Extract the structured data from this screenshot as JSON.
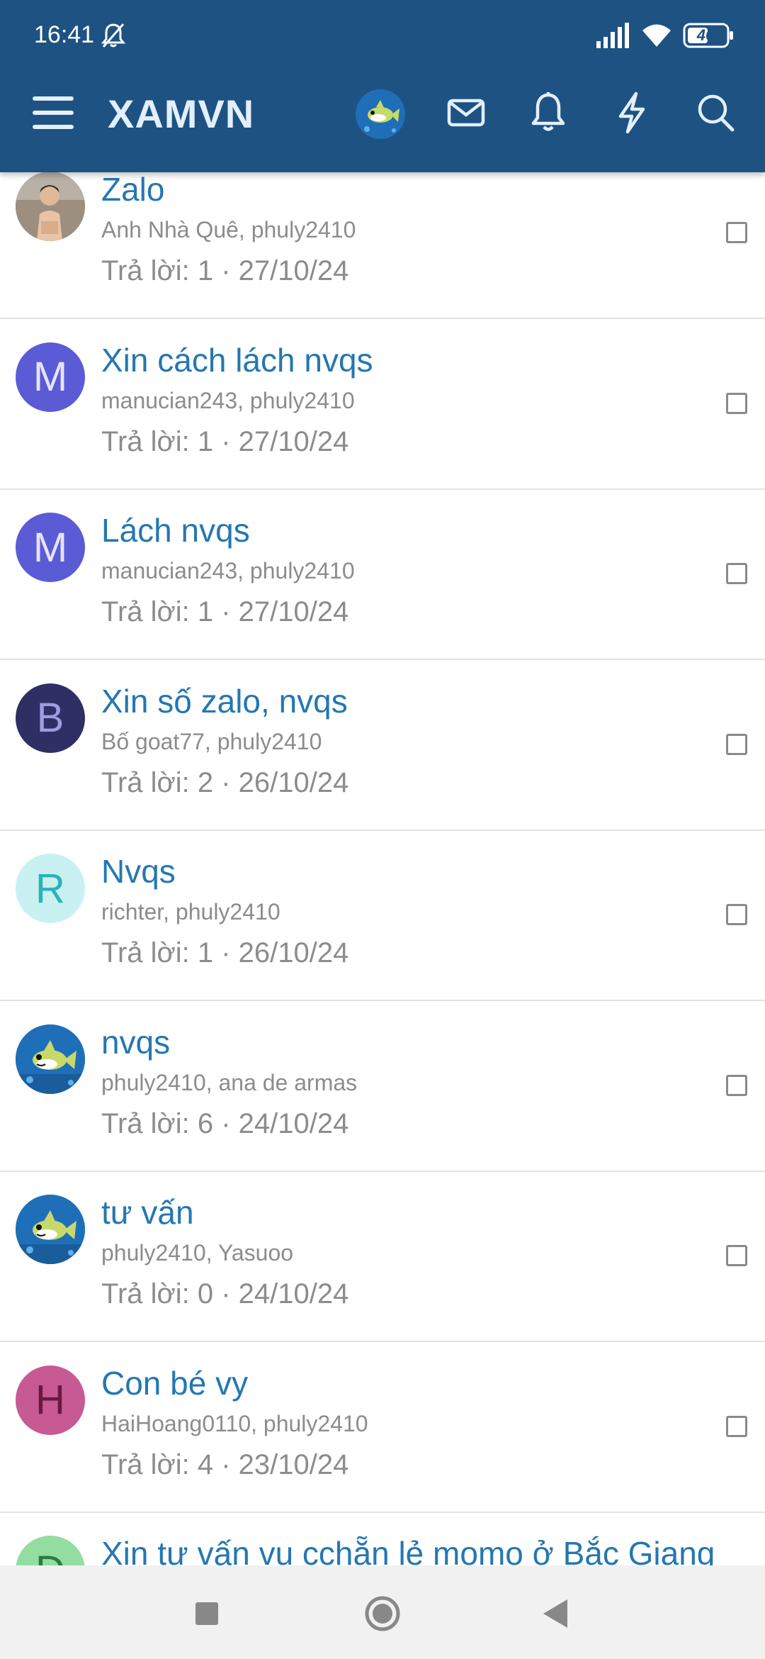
{
  "status_bar": {
    "time": "16:41",
    "battery": "46"
  },
  "app_bar": {
    "title": "XAMVN"
  },
  "colors": {
    "header_bg": "#1d5283",
    "title_link": "#2577b1",
    "muted_text": "#8c8c8c"
  },
  "threads": [
    {
      "title": "Zalo",
      "authors": "Anh Nhà Quê, phuly2410",
      "meta": "Trả lời: 1 · 27/10/24",
      "avatar": {
        "type": "photo",
        "letter": "",
        "bg": "#8a7b6a",
        "fg": "#ffffff"
      }
    },
    {
      "title": "Xin cách lách nvqs",
      "authors": "manucian243, phuly2410",
      "meta": "Trả lời: 1 · 27/10/24",
      "avatar": {
        "type": "letter",
        "letter": "M",
        "bg": "#5b5bd6",
        "fg": "#e6e4ff"
      }
    },
    {
      "title": "Lách nvqs",
      "authors": "manucian243, phuly2410",
      "meta": "Trả lời: 1 · 27/10/24",
      "avatar": {
        "type": "letter",
        "letter": "M",
        "bg": "#5b5bd6",
        "fg": "#e6e4ff"
      }
    },
    {
      "title": "Xin số zalo, nvqs",
      "authors": "Bố goat77, phuly2410",
      "meta": "Trả lời: 2 · 26/10/24",
      "avatar": {
        "type": "letter",
        "letter": "B",
        "bg": "#2f2f66",
        "fg": "#9d9de0"
      }
    },
    {
      "title": "Nvqs",
      "authors": "richter, phuly2410",
      "meta": "Trả lời: 1 · 26/10/24",
      "avatar": {
        "type": "letter",
        "letter": "R",
        "bg": "#c9f1f1",
        "fg": "#2ab3b8"
      }
    },
    {
      "title": "nvqs",
      "authors": "phuly2410, ana de armas",
      "meta": "Trả lời: 6 · 24/10/24",
      "avatar": {
        "type": "shark",
        "letter": "",
        "bg": "#1f6fb8",
        "fg": "#ffffff"
      }
    },
    {
      "title": "tư vấn",
      "authors": "phuly2410, Yasuoo",
      "meta": "Trả lời: 0 · 24/10/24",
      "avatar": {
        "type": "shark",
        "letter": "",
        "bg": "#1f6fb8",
        "fg": "#ffffff"
      }
    },
    {
      "title": "Con bé vy",
      "authors": "HaiHoang0110, phuly2410",
      "meta": "Trả lời: 4 · 23/10/24",
      "avatar": {
        "type": "letter",
        "letter": "H",
        "bg": "#c75a93",
        "fg": "#6a1840"
      }
    },
    {
      "title": "Xin tư vấn vụ cchẵn lẻ momo ở Bắc Giang",
      "authors": "",
      "meta": "",
      "avatar": {
        "type": "letter",
        "letter": "D",
        "bg": "#93dda0",
        "fg": "#2e7a3b"
      }
    }
  ]
}
